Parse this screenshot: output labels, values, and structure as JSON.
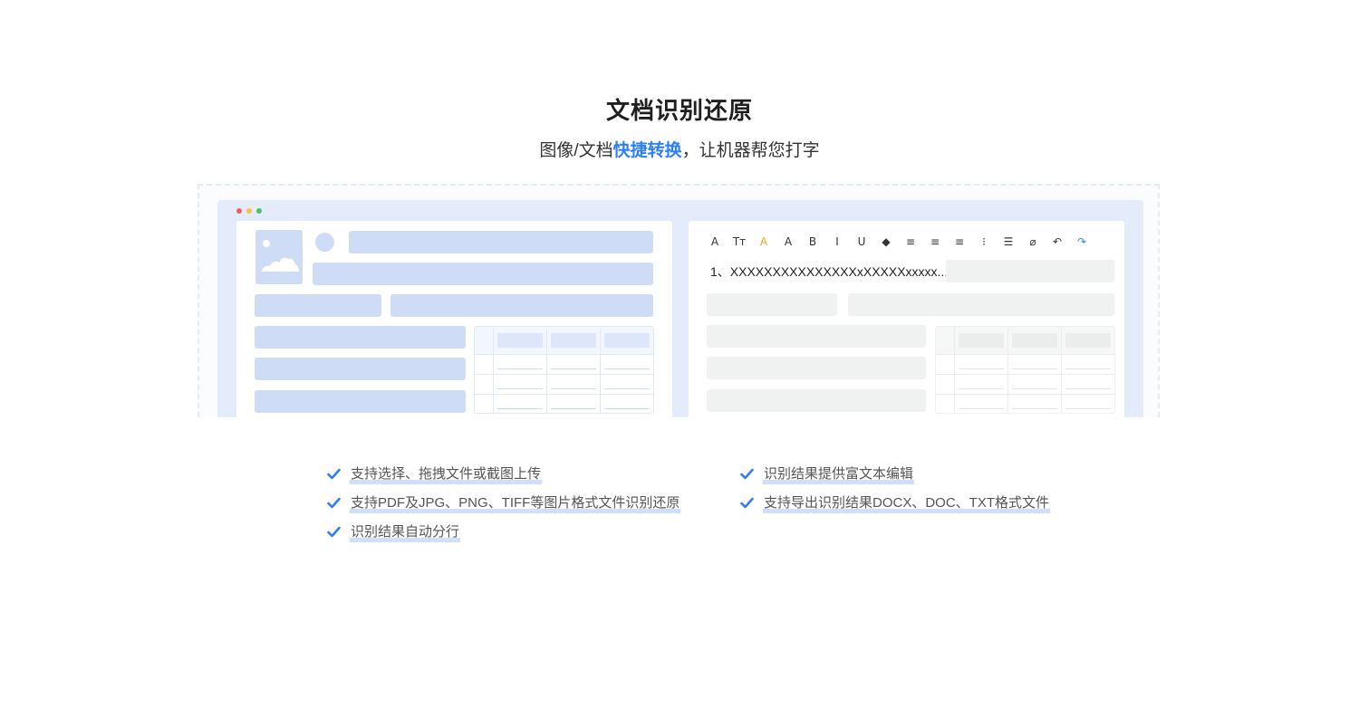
{
  "header": {
    "title": "文档识别还原",
    "subtitle_prefix": "图像/文档",
    "subtitle_highlight": "快捷转换",
    "subtitle_suffix": "，让机器帮您打字"
  },
  "editor": {
    "ocr_line": "1、XXXXXXXXXXXXXXXxXXXXXxxxxx...",
    "toolbar": [
      {
        "icon": "font-size-icon",
        "glyph": "A"
      },
      {
        "icon": "text-case-icon",
        "glyph": "Tт"
      },
      {
        "icon": "font-color-icon",
        "glyph": "A"
      },
      {
        "icon": "highlight-icon",
        "glyph": "A"
      },
      {
        "icon": "bold-icon",
        "glyph": "B"
      },
      {
        "icon": "italic-icon",
        "glyph": "I"
      },
      {
        "icon": "underline-icon",
        "glyph": "U"
      },
      {
        "icon": "eraser-icon",
        "glyph": "◆"
      },
      {
        "icon": "align-left-icon",
        "glyph": "≡"
      },
      {
        "icon": "align-center-icon",
        "glyph": "≡"
      },
      {
        "icon": "align-right-icon",
        "glyph": "≡"
      },
      {
        "icon": "ordered-list-icon",
        "glyph": "⁝"
      },
      {
        "icon": "checklist-icon",
        "glyph": "☰"
      },
      {
        "icon": "attachment-icon",
        "glyph": "⌀"
      },
      {
        "icon": "undo-icon",
        "glyph": "↶"
      },
      {
        "icon": "redo-icon",
        "glyph": "↷"
      }
    ]
  },
  "features": [
    "支持选择、拖拽文件或截图上传",
    "识别结果提供富文本编辑",
    "支持PDF及JPG、PNG、TIFF等图片格式文件识别还原",
    "支持导出识别结果DOCX、DOC、TXT格式文件",
    "识别结果自动分行"
  ],
  "colors": {
    "accent": "#2d7ff9",
    "check": "#2d7ff9",
    "placeholder_blue": "#cfdcf6",
    "placeholder_gray": "#f0f1f1",
    "window_bg": "#e4ecfb"
  }
}
